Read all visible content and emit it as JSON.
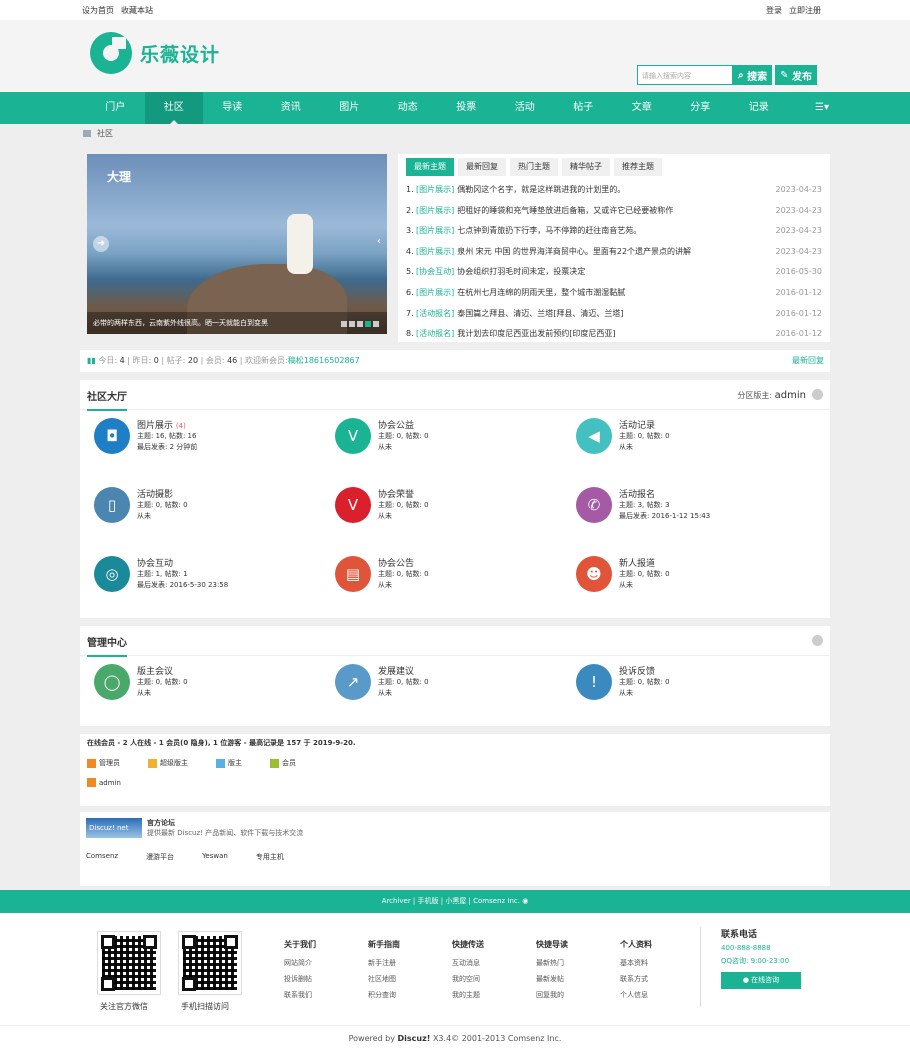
{
  "topbar": {
    "set_home": "设为首页",
    "bookmark": "收藏本站",
    "login": "登录",
    "register": "立即注册"
  },
  "logo": {
    "text": "乐薇设计"
  },
  "search": {
    "placeholder": "请输入搜索内容",
    "search_label": "搜索",
    "post_label": "发布"
  },
  "nav": {
    "items": [
      {
        "label": "门户"
      },
      {
        "label": "社区"
      },
      {
        "label": "导读"
      },
      {
        "label": "资讯"
      },
      {
        "label": "图片"
      },
      {
        "label": "动态"
      },
      {
        "label": "投票"
      },
      {
        "label": "活动"
      },
      {
        "label": "帖子"
      },
      {
        "label": "文章"
      },
      {
        "label": "分享"
      },
      {
        "label": "记录"
      }
    ],
    "active": 1,
    "menu_icon": "list-icon"
  },
  "breadcrumb": {
    "current": "社区"
  },
  "slider": {
    "caption": "必带的两样东西，云南紫外线很高。晒一天就能白到变黑",
    "title": "大理"
  },
  "thread_tabs": {
    "tabs": [
      "最新主题",
      "最新回复",
      "热门主题",
      "精华帖子",
      "推荐主题"
    ],
    "active": 0
  },
  "threads": [
    {
      "num": "1.",
      "cat": "[图片展示]",
      "title": "偶勒冈这个名字，就是这样跳进我的计划里的。",
      "date": "2023-04-23"
    },
    {
      "num": "2.",
      "cat": "[图片展示]",
      "title": "把租好的睡袋和充气睡垫放进后备箱，又或许它已经要被称作",
      "date": "2023-04-23"
    },
    {
      "num": "3.",
      "cat": "[图片展示]",
      "title": "七点钟到青旅扔下行李，马不停蹄的赶往南音艺苑。",
      "date": "2023-04-23"
    },
    {
      "num": "4.",
      "cat": "[图片展示]",
      "title": "泉州 宋元 中国 的世界海洋商贸中心。里面有22个遗产景点的讲解",
      "date": "2023-04-23"
    },
    {
      "num": "5.",
      "cat": "[协会互动]",
      "title": "协会组织打羽毛时间未定，投票决定",
      "date": "2016-05-30"
    },
    {
      "num": "6.",
      "cat": "[图片展示]",
      "title": "在杭州七月连绵的阴雨天里，整个城市潮湿黏腻",
      "date": "2016-01-12"
    },
    {
      "num": "7.",
      "cat": "[活动报名]",
      "title": "泰国篇之拜县、清迈、兰塔[拜县、清迈、兰塔]",
      "date": "2016-01-12"
    },
    {
      "num": "8.",
      "cat": "[活动报名]",
      "title": "我计划去印度尼西亚出发前预约[印度尼西亚]",
      "date": "2016-01-12"
    }
  ],
  "stats": {
    "today_label": "今日:",
    "today": "4",
    "yesterday_label": "昨日:",
    "yesterday": "0",
    "posts_label": "帖子:",
    "posts": "20",
    "members_label": "会员:",
    "members": "46",
    "welcome": "欢迎新会员:",
    "newest": "稿松18616502867",
    "latest_reply": "最新回复"
  },
  "hall": {
    "title": "社区大厅",
    "moderator_label": "分区版主:",
    "moderator": "admin"
  },
  "forums": [
    {
      "name": "图片展示",
      "count": "(4)",
      "l1": "主题: 16, 帖数: 16",
      "l2": "最后发表: 2 分钟前",
      "color": "#1e7fc4",
      "icon": "camera-icon",
      "glyph": "◘"
    },
    {
      "name": "协会公益",
      "count": "",
      "l1": "主题: 0, 帖数: 0",
      "l2": "从未",
      "color": "#1ab394",
      "icon": "vine-icon",
      "glyph": "V"
    },
    {
      "name": "活动记录",
      "count": "",
      "l1": "主题: 0, 帖数: 0",
      "l2": "从未",
      "color": "#45c0c0",
      "icon": "megaphone-icon",
      "glyph": "◀"
    },
    {
      "name": "活动摄影",
      "count": "",
      "l1": "主题: 0, 帖数: 0",
      "l2": "从未",
      "color": "#4a86b0",
      "icon": "phone-icon",
      "glyph": "▯"
    },
    {
      "name": "协会荣誉",
      "count": "",
      "l1": "主题: 0, 帖数: 0",
      "l2": "从未",
      "color": "#d9202c",
      "icon": "v-logo-icon",
      "glyph": "V"
    },
    {
      "name": "活动报名",
      "count": "",
      "l1": "主题: 3, 帖数: 3",
      "l2": "最后发表: 2016-1-12 15:43",
      "color": "#a55aa5",
      "icon": "telephone-icon",
      "glyph": "✆"
    },
    {
      "name": "协会互动",
      "count": "",
      "l1": "主题: 1, 帖数: 1",
      "l2": "最后发表: 2016-5-30 23:58",
      "color": "#1a8a9a",
      "icon": "chat-dots-icon",
      "glyph": "◎"
    },
    {
      "name": "协会公告",
      "count": "",
      "l1": "主题: 0, 帖数: 0",
      "l2": "从未",
      "color": "#e0553a",
      "icon": "document-icon",
      "glyph": "▤"
    },
    {
      "name": "新人报道",
      "count": "",
      "l1": "主题: 0, 帖数: 0",
      "l2": "从未",
      "color": "#e0553a",
      "icon": "user-icon",
      "glyph": "☻"
    }
  ],
  "admin": {
    "title": "管理中心"
  },
  "admin_forums": [
    {
      "name": "版主会议",
      "l1": "主题: 0, 帖数: 0",
      "l2": "从未",
      "color": "#4aa86a",
      "icon": "speech-bubble-icon",
      "glyph": "◯"
    },
    {
      "name": "发展建议",
      "l1": "主题: 0, 帖数: 0",
      "l2": "从未",
      "color": "#5a9ac8",
      "icon": "line-chart-icon",
      "glyph": "↗"
    },
    {
      "name": "投诉反馈",
      "l1": "主题: 0, 帖数: 0",
      "l2": "从未",
      "color": "#3a8ac0",
      "icon": "exclamation-icon",
      "glyph": "!"
    }
  ],
  "online": {
    "summary": "在线会员 - 2 人在线 - 1 会员(0 隐身), 1 位游客 - 最高记录是 157 于 2019-9-20.",
    "legend": [
      {
        "label": "管理员",
        "color": "#f08a24"
      },
      {
        "label": "超级版主",
        "color": "#f0b030"
      },
      {
        "label": "版主",
        "color": "#5ab0e0"
      },
      {
        "label": "会员",
        "color": "#9ac030"
      }
    ],
    "user": "admin"
  },
  "links": {
    "badge": "Discuz! net",
    "title": "官方论坛",
    "desc": "提供最新 Discuz! 产品新闻、软件下载与技术交流",
    "items": [
      "Comsenz",
      "漫游平台",
      "Yeswan",
      "专用主机"
    ]
  },
  "footbar": {
    "text": "Archiver | 手机版 | 小黑屋 | Comsenz Inc."
  },
  "footer": {
    "qr1": "关注官方微信",
    "qr2": "手机扫描访问",
    "cols": [
      {
        "title": "关于我们",
        "items": [
          "网站简介",
          "投诉删帖",
          "联系我们"
        ]
      },
      {
        "title": "新手指南",
        "items": [
          "新手注册",
          "社区地图",
          "积分查询"
        ]
      },
      {
        "title": "快捷传送",
        "items": [
          "互动消息",
          "我的空间",
          "我的主题"
        ]
      },
      {
        "title": "快捷导读",
        "items": [
          "最新热门",
          "最新发帖",
          "回复我的"
        ]
      },
      {
        "title": "个人资料",
        "items": [
          "基本资料",
          "联系方式",
          "个人信息"
        ]
      }
    ],
    "contact_title": "联系电话",
    "phone": "400-888-8888",
    "hours": "QQ咨询: 9:00-23:00",
    "consult": "在线咨询"
  },
  "powered": {
    "prefix": "Powered by ",
    "brand": "Discuz!",
    "suffix": " X3.4© 2001-2013 Comsenz Inc."
  }
}
